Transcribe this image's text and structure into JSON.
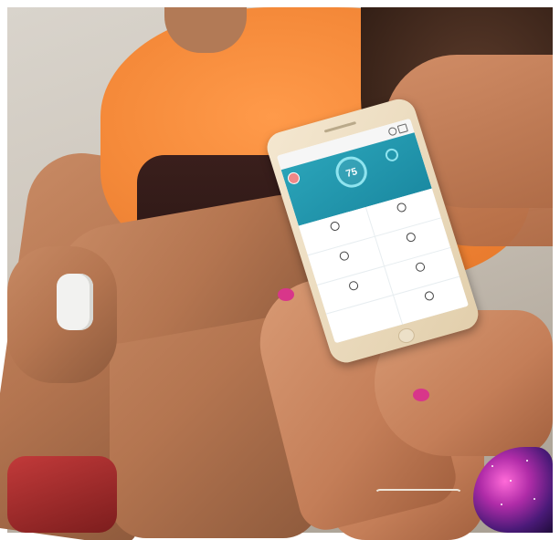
{
  "scene": {
    "description_type": "photo",
    "subject_colors": {
      "shirt": "#f58a3a",
      "shorts": "#2a1614",
      "watch_band": "#f2f2f0",
      "nail_polish": "#d8368a",
      "app_accent": "#1b8aa2"
    }
  },
  "phone_app": {
    "score": "75",
    "tiles": [
      {
        "icon": "dumbbell-icon"
      },
      {
        "icon": "heart-icon"
      },
      {
        "icon": "stopwatch-icon"
      },
      {
        "icon": "scale-icon"
      },
      {
        "icon": "cup-icon"
      },
      {
        "icon": "moon-icon"
      },
      {
        "icon": "blank-icon"
      },
      {
        "icon": "sun-icon"
      }
    ]
  }
}
